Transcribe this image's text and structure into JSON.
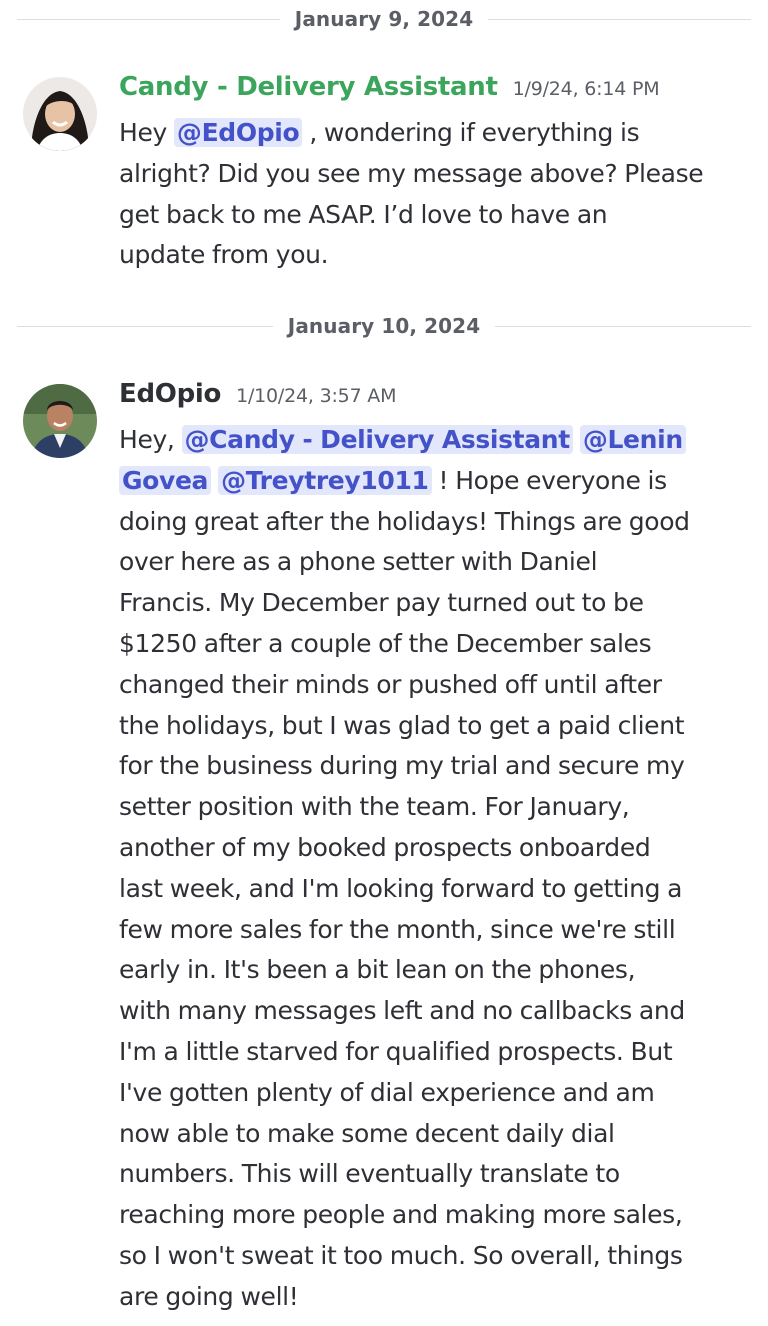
{
  "dividers": [
    {
      "date": "January 9, 2024"
    },
    {
      "date": "January 10, 2024"
    }
  ],
  "colors": {
    "candy_name": "#3ba55c",
    "edopio_name": "#2e3035",
    "mention_bg": "#e3e7fc",
    "mention_text": "#4452c9"
  },
  "messages": [
    {
      "author": "Candy - Delivery Assistant",
      "timestamp": "1/9/24, 6:14 PM",
      "avatar": "candy-avatar",
      "lines": [
        {
          "t1": "Hey ",
          "m1": "@EdOpio",
          "t2": " , wondering if everything is"
        },
        {
          "t1": "alright? Did you see my message above? Please"
        },
        {
          "t1": "get back to me ASAP. I’d love to have an"
        },
        {
          "t1": "update from you."
        }
      ]
    },
    {
      "author": "EdOpio",
      "timestamp": "1/10/24, 3:57 AM",
      "avatar": "edopio-avatar",
      "lines": [
        {
          "t1": "Hey, ",
          "m1": "@Candy - Delivery Assistant",
          "t2": " ",
          "m2": "@Lenin"
        },
        {
          "m1": "Govea",
          "t2": " ",
          "m2": "@Treytrey1011",
          "t3": " !  Hope everyone is"
        },
        {
          "t1": "doing great after the holidays!  Things are good"
        },
        {
          "t1": "over here as a phone setter with Daniel"
        },
        {
          "t1": "Francis.  My December pay turned out to be"
        },
        {
          "t1": "$1250 after a couple of the December sales"
        },
        {
          "t1": "changed their minds or pushed off until after"
        },
        {
          "t1": "the holidays, but I was glad to get a paid client"
        },
        {
          "t1": "for the business during my trial and secure my"
        },
        {
          "t1": "setter position with the team.  For January,"
        },
        {
          "t1": "another of my booked prospects onboarded"
        },
        {
          "t1": "last week, and I'm looking forward to getting a"
        },
        {
          "t1": "few more sales for the month, since we're still"
        },
        {
          "t1": "early in.  It's been a bit lean on the phones,"
        },
        {
          "t1": "with many messages left and no callbacks and"
        },
        {
          "t1": "I'm a little starved for qualified prospects.  But"
        },
        {
          "t1": "I've gotten plenty of dial experience and am"
        },
        {
          "t1": "now able to make some decent daily dial"
        },
        {
          "t1": "numbers.  This will eventually translate to"
        },
        {
          "t1": "reaching more people and making more sales,"
        },
        {
          "t1": "so I won't sweat it too much.  So overall, things"
        },
        {
          "t1": "are going well!"
        }
      ]
    }
  ]
}
